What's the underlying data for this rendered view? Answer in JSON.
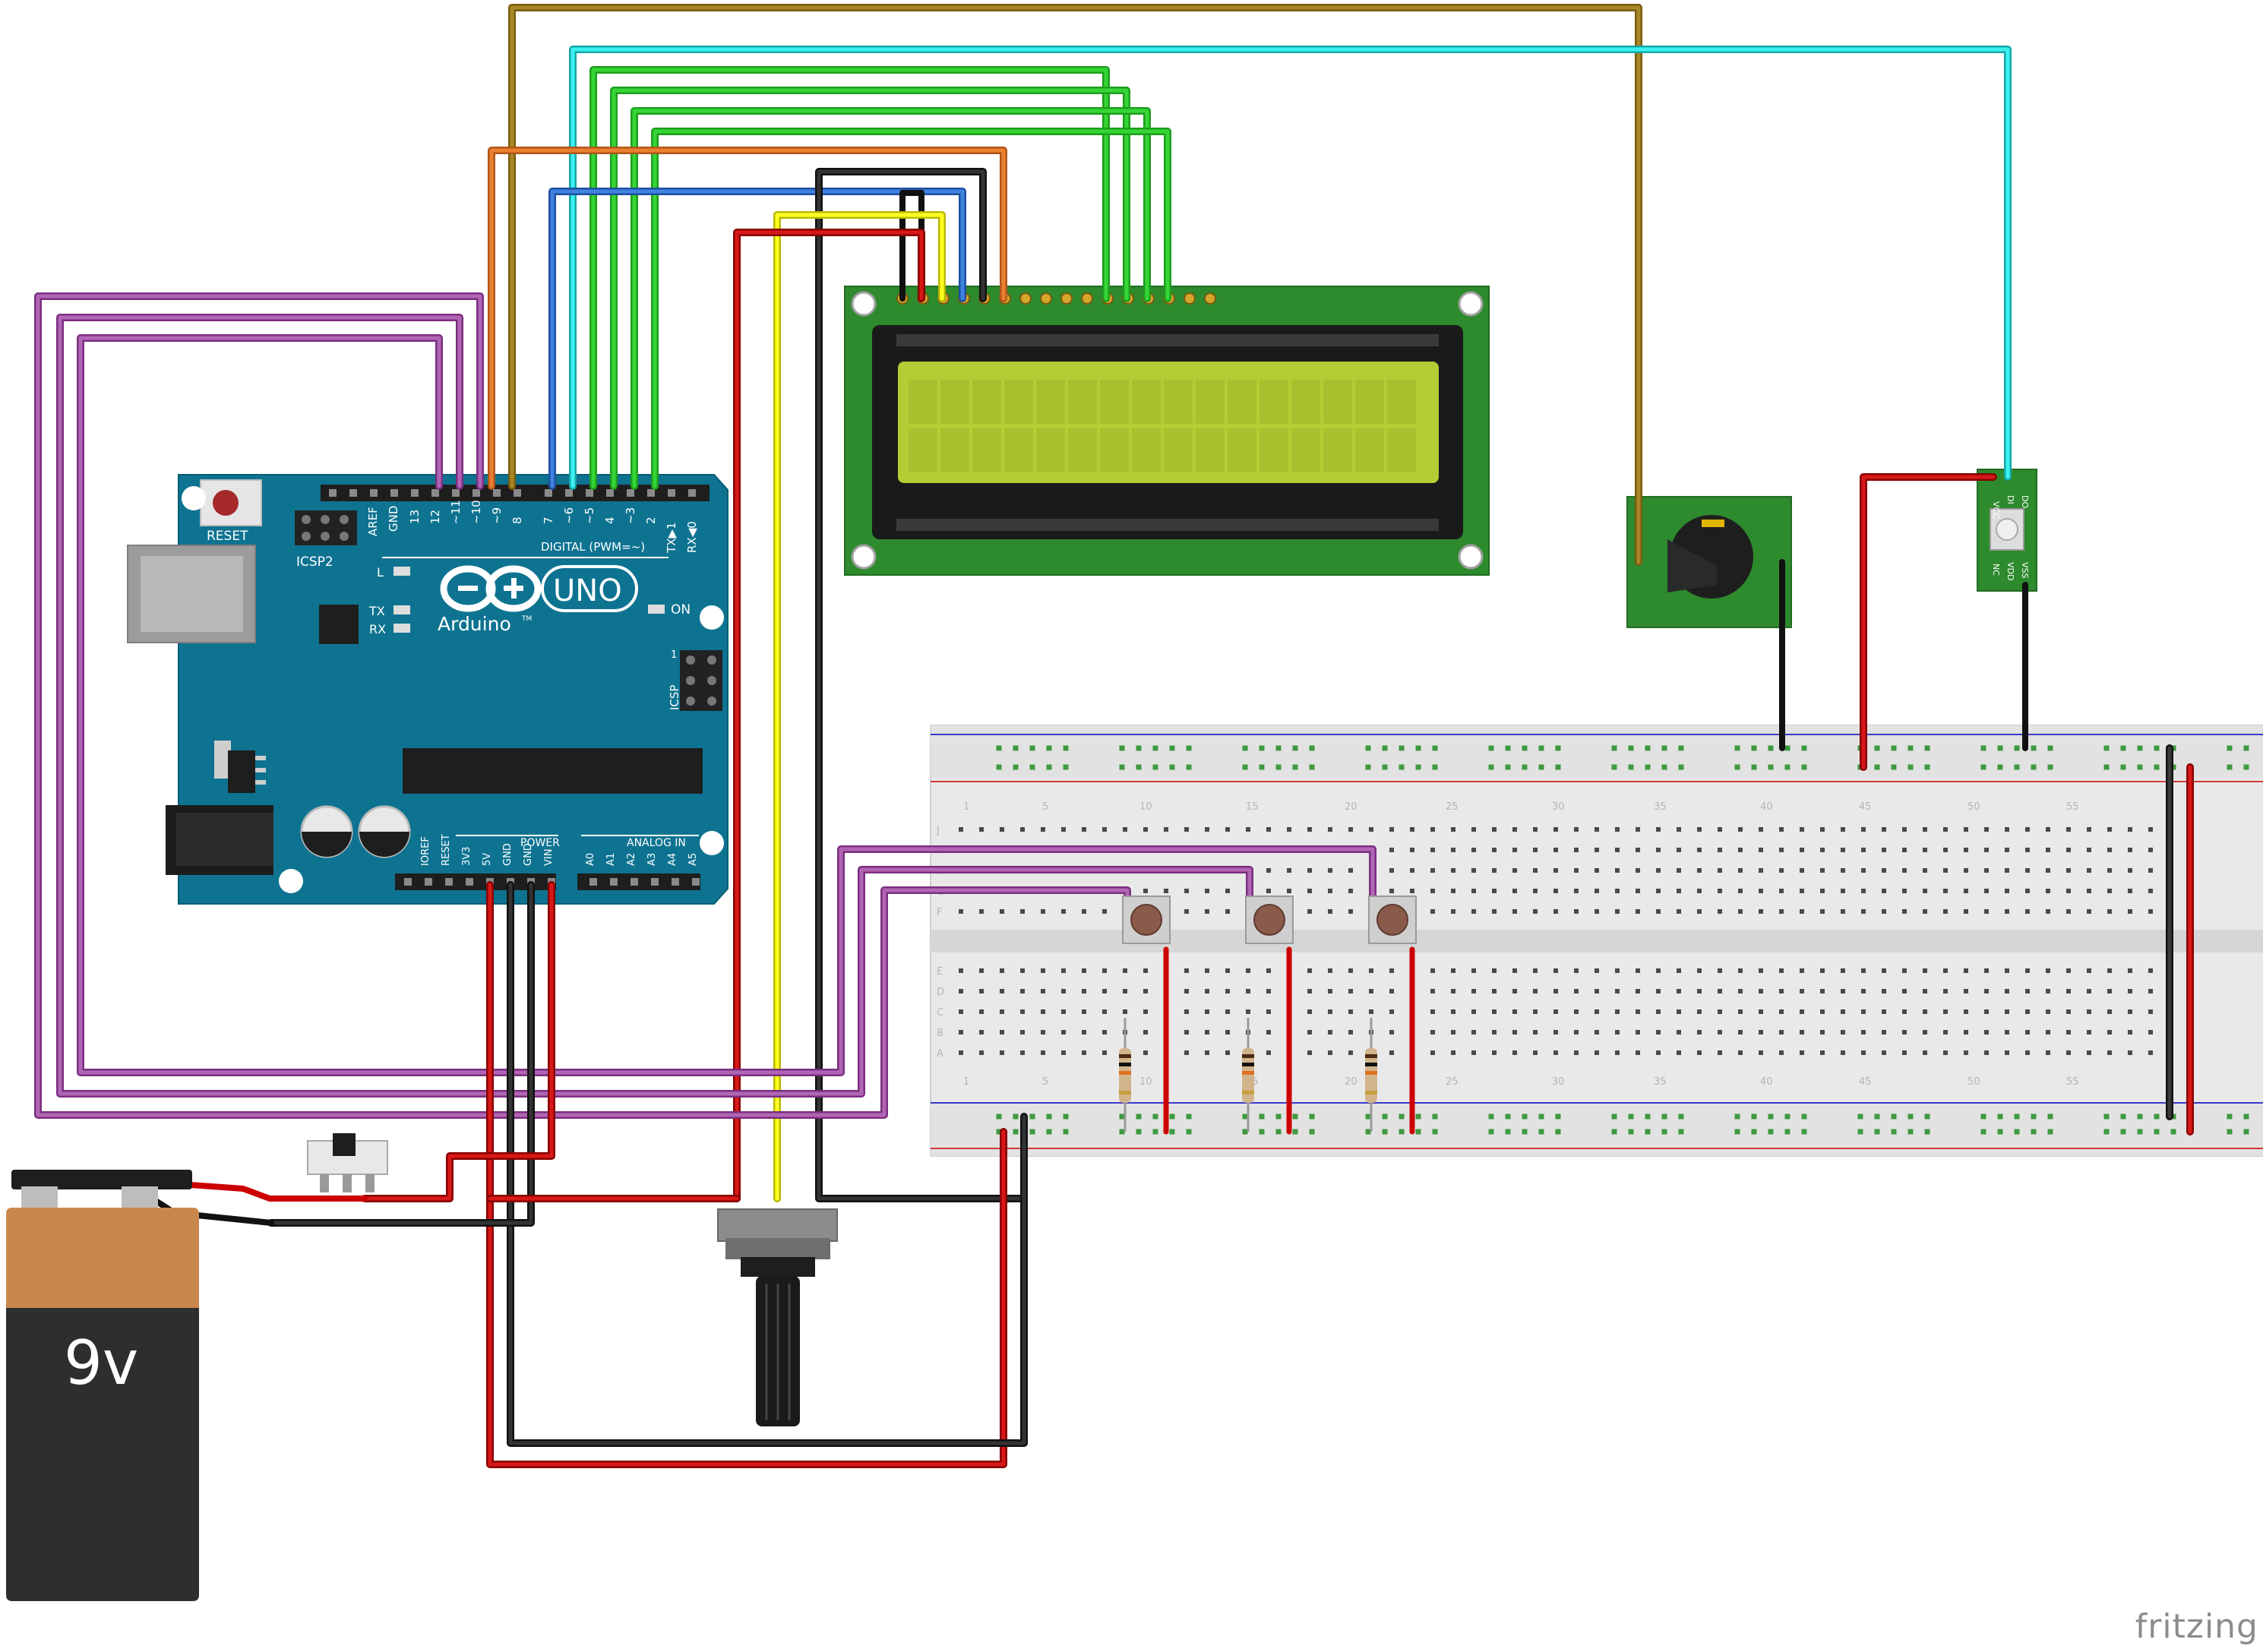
{
  "arduino": {
    "reset": "RESET",
    "icsp2": "ICSP2",
    "icsp": "ICSP",
    "aref": "AREF",
    "gnd": "GND",
    "digital_header": "DIGITAL (PWM=~)",
    "digital_pins": [
      "13",
      "12",
      "~11",
      "~10",
      "~9",
      "8",
      "7",
      "~6",
      "~5",
      "4",
      "~3",
      "2",
      "TX▶1",
      "RX◀0"
    ],
    "logo": "Arduino",
    "tm": "TM",
    "model": "UNO",
    "on": "ON",
    "led_l": "L",
    "led_tx": "TX",
    "led_rx": "RX",
    "icsp_one": "1",
    "power_header": "POWER",
    "power_pins": [
      "IOREF",
      "RESET",
      "3V3",
      "5V",
      "GND",
      "GND",
      "VIN"
    ],
    "analog_header": "ANALOG IN",
    "analog_pins": [
      "A0",
      "A1",
      "A2",
      "A3",
      "A4",
      "A5"
    ]
  },
  "battery": {
    "label": "9v"
  },
  "neopixel": {
    "pins_top": [
      "VCC",
      "DI",
      "DO"
    ],
    "pins_bottom": [
      "NC",
      "VDD",
      "VSS"
    ]
  },
  "breadboard": {
    "top_numbers": [
      "1",
      "5",
      "10",
      "15",
      "20",
      "25",
      "30",
      "35",
      "40",
      "45",
      "50",
      "55"
    ],
    "bottom_numbers": [
      "1",
      "5",
      "10",
      "15",
      "20",
      "25",
      "30",
      "35",
      "40",
      "45",
      "50",
      "55"
    ],
    "row_letters_top": [
      "J",
      "I",
      "H",
      "G",
      "F"
    ],
    "row_letters_bottom": [
      "E",
      "D",
      "C",
      "B",
      "A"
    ]
  },
  "branding": {
    "text": "fritzing"
  },
  "colors": {
    "arduino_blue": "#0e7391",
    "lcd_pcb": "#2d8a2d",
    "lcd_screen": "#b5cc34",
    "wire_red": "#cc0000",
    "wire_black": "#222222",
    "wire_yellow": "#f0f000",
    "wire_cyan": "#29d9d9",
    "wire_green": "#2ec42e",
    "wire_blue": "#2c6fd4",
    "wire_orange": "#e07020",
    "wire_purple": "#a14fa6",
    "wire_brown": "#9a7a1a"
  }
}
